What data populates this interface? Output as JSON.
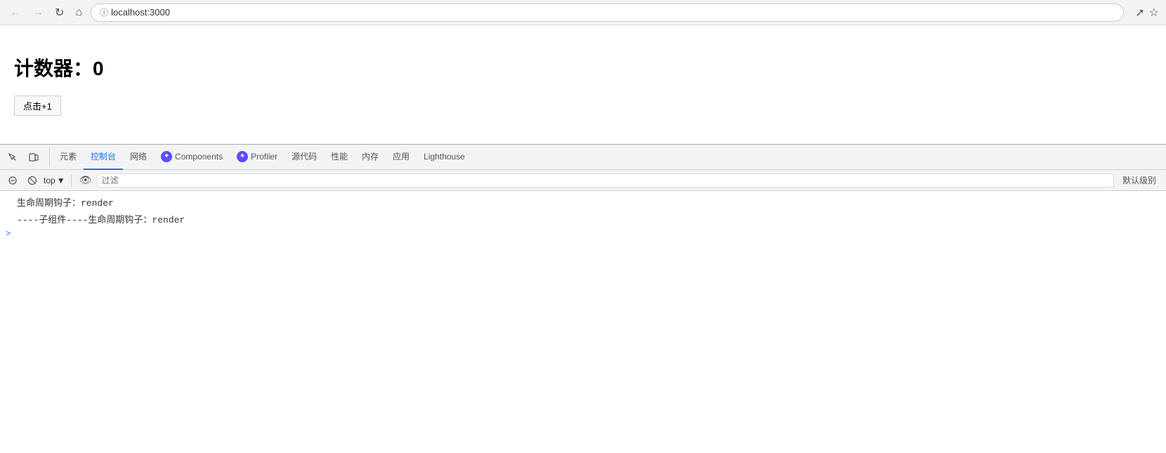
{
  "browser": {
    "url": "localhost:3000",
    "back_disabled": true,
    "forward_disabled": true
  },
  "page": {
    "counter_label": "计数器：0",
    "increment_button": "点击+1"
  },
  "devtools": {
    "tabs": [
      {
        "id": "elements",
        "label": "元素",
        "active": false
      },
      {
        "id": "console",
        "label": "控制台",
        "active": true
      },
      {
        "id": "network",
        "label": "网络",
        "active": false
      },
      {
        "id": "components",
        "label": "Components",
        "active": false,
        "has_react_icon": true
      },
      {
        "id": "profiler",
        "label": "Profiler",
        "active": false,
        "has_react_icon": true
      },
      {
        "id": "sources",
        "label": "源代码",
        "active": false
      },
      {
        "id": "performance",
        "label": "性能",
        "active": false
      },
      {
        "id": "memory",
        "label": "内存",
        "active": false
      },
      {
        "id": "application",
        "label": "应用",
        "active": false
      },
      {
        "id": "lighthouse",
        "label": "Lighthouse",
        "active": false
      }
    ],
    "console": {
      "top_label": "top",
      "filter_placeholder": "过滤",
      "default_level": "默认级别",
      "lines": [
        "生命周期钩子：render",
        "----子组件----生命周期钩子：render"
      ]
    }
  }
}
